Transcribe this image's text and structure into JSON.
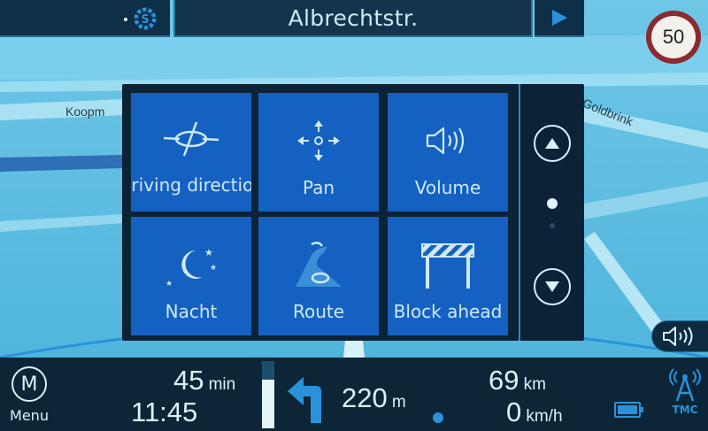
{
  "top_bar": {
    "street_name": "Albrechtstr.",
    "settings_icon": "settings-gear-icon",
    "destination_icon": "navigation-arrow-icon"
  },
  "speed_limit": "50",
  "map": {
    "labels": [
      "Koopm",
      "Goldbrink"
    ]
  },
  "quick_menu": {
    "tiles": [
      {
        "label": "Driving direction",
        "icon": "compass-icon"
      },
      {
        "label": "Pan",
        "icon": "pan-arrows-icon"
      },
      {
        "label": "Volume",
        "icon": "speaker-icon"
      },
      {
        "label": "Nacht",
        "icon": "moon-stars-icon"
      },
      {
        "label": "Route",
        "icon": "route-road-icon"
      },
      {
        "label": "Block ahead",
        "icon": "roadblock-icon"
      }
    ],
    "scroll_up_icon": "chevron-up-icon",
    "scroll_down_icon": "chevron-down-icon"
  },
  "bottom_bar": {
    "menu_symbol": "M",
    "menu_label": "Menu",
    "remaining_time": "45",
    "remaining_time_unit": "min",
    "arrival_time": "11:45",
    "route_progress": 0.72,
    "turn_icon": "turn-left-arrow-icon",
    "turn_distance": "220",
    "turn_distance_unit": "m",
    "remaining_distance": "69",
    "remaining_distance_unit": "km",
    "current_speed": "0",
    "current_speed_unit": "km/h",
    "battery_level": 1.0,
    "tmc_label": "TMC"
  },
  "colors": {
    "tile_blue": "#1461c2",
    "accent_blue": "#2b92d9",
    "speed_sign_ring": "#8b2a2f"
  }
}
